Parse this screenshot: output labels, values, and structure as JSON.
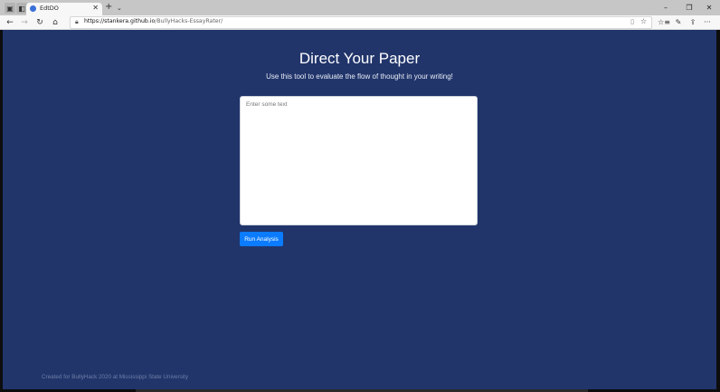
{
  "browser": {
    "tabs": [
      {
        "label": ""
      },
      {
        "label": ""
      },
      {
        "label": "EdtDO",
        "active": true
      }
    ],
    "new_tab_icon": "+",
    "tab_list_icon": "⌄",
    "close_tab_icon": "✕",
    "window_controls": {
      "minimize": "–",
      "maximize": "❐",
      "close": "✕"
    },
    "nav": {
      "back": "←",
      "forward": "→",
      "refresh": "↻",
      "home": "⌂"
    },
    "url_host": "https://stankera.github.io",
    "url_path": "/BullyHacks-EssayRater/",
    "toolbar_icons": {
      "reading": "▯",
      "favorite": "☆",
      "favorites_bar": "☆≡",
      "notes": "✎",
      "share": "⇪",
      "more": "···"
    }
  },
  "page": {
    "title": "Direct Your Paper",
    "subtitle": "Use this tool to evaluate the flow of thought in your writing!",
    "textarea_placeholder": "Enter some text",
    "textarea_value": "",
    "run_button_label": "Run Analysis",
    "footer": "Created for BullyHack 2020 at Mississippi State University"
  },
  "colors": {
    "page_background": "#21356b",
    "button": "#0b7bff",
    "footer_text": "#6f7ea6"
  }
}
